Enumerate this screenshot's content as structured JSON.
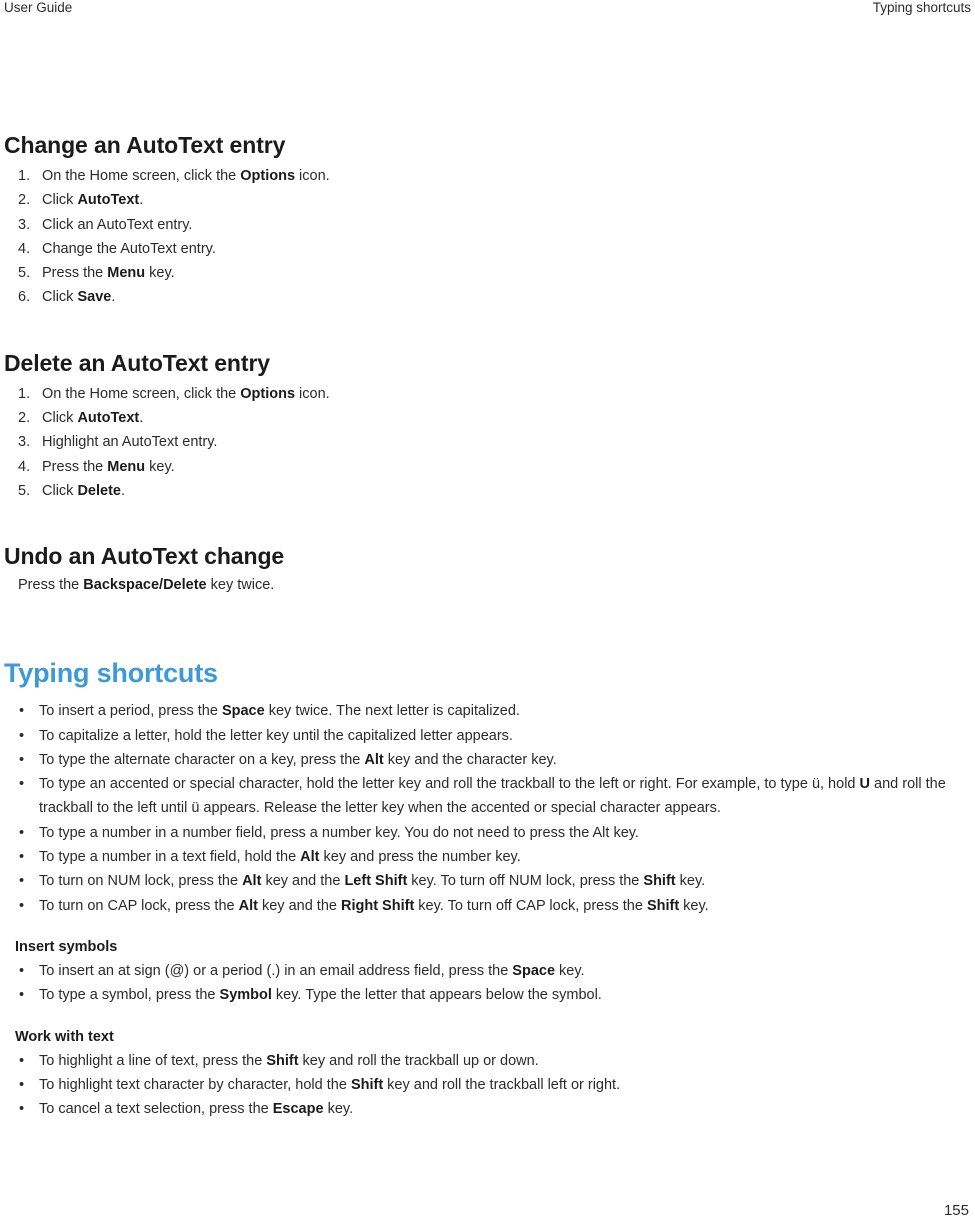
{
  "running_head": {
    "left": "User Guide",
    "right": "Typing shortcuts"
  },
  "sections": [
    {
      "id": "change-autotext-entry",
      "heading": "Change an AutoText entry",
      "type": "ordered",
      "items": [
        {
          "num": "1.",
          "html": "On the Home screen, click the <b>Options</b> icon."
        },
        {
          "num": "2.",
          "html": "Click <b>AutoText</b>."
        },
        {
          "num": "3.",
          "html": "Click an AutoText entry."
        },
        {
          "num": "4.",
          "html": "Change the AutoText entry."
        },
        {
          "num": "5.",
          "html": "Press the <b>Menu</b> key."
        },
        {
          "num": "6.",
          "html": "Click <b>Save</b>."
        }
      ]
    },
    {
      "id": "delete-autotext-entry",
      "heading": "Delete an AutoText entry",
      "type": "ordered",
      "items": [
        {
          "num": "1.",
          "html": "On the Home screen, click the <b>Options</b> icon."
        },
        {
          "num": "2.",
          "html": "Click <b>AutoText</b>."
        },
        {
          "num": "3.",
          "html": "Highlight an AutoText entry."
        },
        {
          "num": "4.",
          "html": "Press the <b>Menu</b> key."
        },
        {
          "num": "5.",
          "html": "Click <b>Delete</b>."
        }
      ]
    },
    {
      "id": "undo-autotext-change",
      "heading": "Undo an AutoText change",
      "type": "paragraph",
      "paragraph_html": "Press the <b>Backspace/Delete</b> key twice."
    }
  ],
  "chapter": {
    "id": "typing-shortcuts",
    "heading": "Typing shortcuts",
    "color": "#3d9ad6",
    "bullets": [
      {
        "html": "To insert a period, press the <b>Space</b> key twice. The next letter is capitalized."
      },
      {
        "html": "To capitalize a letter, hold the letter key until the capitalized letter appears."
      },
      {
        "html": "To type the alternate character on a key, press the <b>Alt</b> key and the character key."
      },
      {
        "html": "To type an accented or special character, hold the letter key and roll the trackball to the left or right. For example, to type ü, hold <b>U</b> and roll the trackball to the left until ü appears. Release the letter key when the accented or special character appears."
      },
      {
        "html": "To type a number in a number field, press a number key. You do not need to press the Alt key."
      },
      {
        "html": "To type a number in a text field, hold the <b>Alt</b> key and press the number key."
      },
      {
        "html": "To turn on NUM lock, press the <b>Alt</b> key and the <b>Left Shift</b> key. To turn off NUM lock, press the <b>Shift</b> key."
      },
      {
        "html": "To turn on CAP lock, press the <b>Alt</b> key and the <b>Right Shift</b> key. To turn off CAP lock, press the <b>Shift</b> key."
      }
    ],
    "subsections": [
      {
        "id": "insert-symbols",
        "heading": "Insert symbols",
        "bullets": [
          {
            "html": "To insert an at sign (@) or a period (.) in an email address field, press the <b>Space</b> key."
          },
          {
            "html": "To type a symbol, press the <b>Symbol</b> key. Type the letter that appears below the symbol."
          }
        ]
      },
      {
        "id": "work-with-text",
        "heading": "Work with text",
        "bullets": [
          {
            "html": "To highlight a line of text, press the <b>Shift</b> key and roll the trackball up or down."
          },
          {
            "html": "To highlight text character by character, hold the <b>Shift</b> key and roll the trackball left or right."
          },
          {
            "html": "To cancel a text selection, press the <b>Escape</b> key."
          }
        ]
      }
    ]
  },
  "bullet_glyph": "•",
  "folio": {
    "page_number": "155"
  }
}
